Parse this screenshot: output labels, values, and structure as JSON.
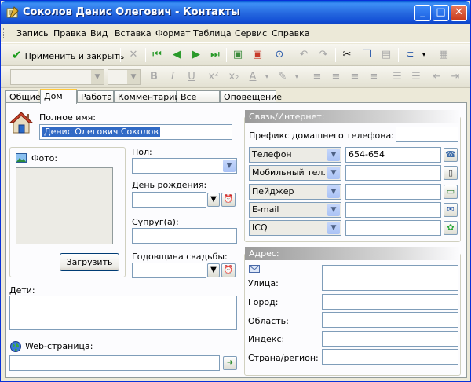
{
  "window": {
    "title": "Соколов Денис Олегович - Контакты"
  },
  "menu": [
    "Запись",
    "Правка",
    "Вид",
    "Вставка",
    "Формат",
    "Таблица",
    "Сервис",
    "Справка"
  ],
  "toolbar": {
    "apply_label": "Применить и закрыть"
  },
  "format_toolbar": {
    "bold": "B",
    "italic": "I",
    "underline": "U",
    "sup": "x²",
    "sub": "x₂",
    "font_color": "A"
  },
  "tabs": [
    "Общие",
    "Дом",
    "Работа",
    "Комментарий",
    "Все поля",
    "Оповещение"
  ],
  "active_tab": "Дом",
  "home": {
    "full_name_label": "Полное имя:",
    "full_name_value": "Денис Олегович Соколов",
    "photo_label": "Фото:",
    "load_button": "Загрузить",
    "gender_label": "Пол:",
    "birthday_label": "День рождения:",
    "spouse_label": "Супруг(а):",
    "anniversary_label": "Годовщина свадьбы:",
    "children_label": "Дети:",
    "webpage_label": "Web-страница:"
  },
  "communication": {
    "title": "Связь/Интернет:",
    "prefix_label": "Префикс домашнего телефона:",
    "rows": [
      {
        "type": "Телефон",
        "value": "654-654",
        "icon": "phone-icon",
        "glyph": "☎"
      },
      {
        "type": "Мобильный тел.",
        "value": "",
        "icon": "mobile-phone-icon",
        "glyph": "▯"
      },
      {
        "type": "Пейджер",
        "value": "",
        "icon": "pager-icon",
        "glyph": "▭"
      },
      {
        "type": "E-mail",
        "value": "",
        "icon": "envelope-icon",
        "glyph": "✉"
      },
      {
        "type": "ICQ",
        "value": "",
        "icon": "icq-flower-icon",
        "glyph": "✿"
      }
    ]
  },
  "address": {
    "title": "Адрес:",
    "street_label": "Улица:",
    "city_label": "Город:",
    "region_label": "Область:",
    "zip_label": "Индекс:",
    "country_label": "Страна/регион:"
  }
}
